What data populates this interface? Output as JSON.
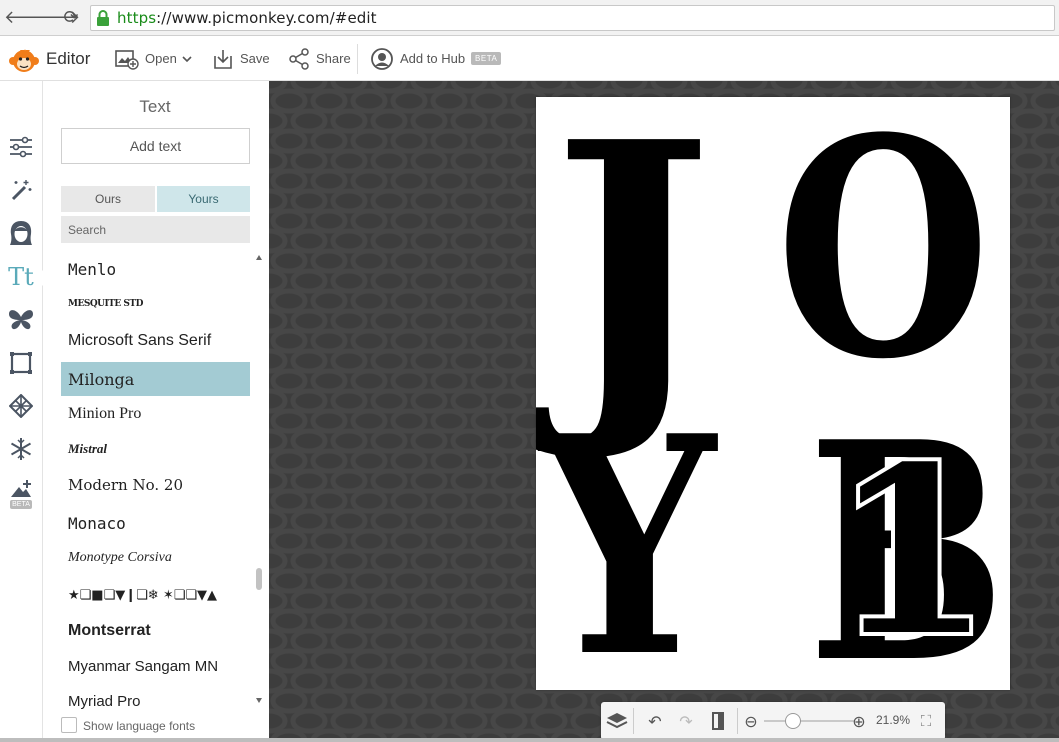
{
  "browser": {
    "url_scheme": "https",
    "url_rest": "://www.picmonkey.com/#edit",
    "back_glyph": "🡐",
    "forward_glyph": "🡒",
    "reload_glyph": "⟳"
  },
  "toolbar": {
    "editor_label": "Editor",
    "open_label": "Open",
    "save_label": "Save",
    "share_label": "Share",
    "hub_label": "Add to Hub",
    "hub_badge": "BETA"
  },
  "rail": {
    "beta_badge": "BETA",
    "text_tool_glyph": "Tt",
    "icons": [
      "sliders-icon",
      "magic-wand-icon",
      "face-icon",
      "text-icon",
      "butterfly-icon",
      "frame-icon",
      "texture-icon",
      "snowflake-icon",
      "custom-design-icon"
    ]
  },
  "panel": {
    "title": "Text",
    "add_text_label": "Add text",
    "tab_ours": "Ours",
    "tab_yours": "Yours",
    "search_placeholder": "Search",
    "show_language_fonts": "Show language fonts",
    "fonts": [
      {
        "label": "Menlo",
        "selected": false
      },
      {
        "label": "MESQUITE STD",
        "selected": false
      },
      {
        "label": "Microsoft Sans Serif",
        "selected": false
      },
      {
        "label": "Milonga",
        "selected": true
      },
      {
        "label": "Minion Pro",
        "selected": false
      },
      {
        "label": "Mistral",
        "selected": false
      },
      {
        "label": "Modern No. 20",
        "selected": false
      },
      {
        "label": "Monaco",
        "selected": false
      },
      {
        "label": "Monotype Corsiva",
        "selected": false
      },
      {
        "label": "★❏■❏▼❙❏❄ ✶❏❏▼▲",
        "selected": false
      },
      {
        "label": "Montserrat",
        "selected": false
      },
      {
        "label": "Myanmar Sangam MN",
        "selected": false
      },
      {
        "label": "Myriad Pro",
        "selected": false
      }
    ]
  },
  "canvas": {
    "letters": [
      "J",
      "O",
      "Y",
      "B",
      "1"
    ]
  },
  "canvas_toolbar": {
    "zoom_out_glyph": "⊖",
    "zoom_in_glyph": "⊕",
    "zoom_value": "21.9%",
    "undo_glyph": "↶",
    "redo_glyph": "↷",
    "fullscreen_glyph": "⛶"
  },
  "colors": {
    "accent_teal": "#a3cbd3",
    "url_green": "#1a8c1a",
    "canvas_bg": "#3d3d3d",
    "brand_orange": "#f07d1a"
  }
}
